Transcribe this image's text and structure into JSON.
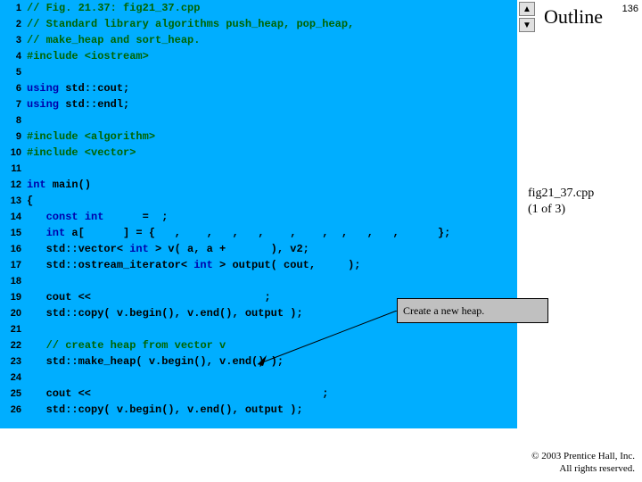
{
  "page_number": "136",
  "outline_label": "Outline",
  "fig_file": "fig21_37.cpp",
  "fig_part": "(1 of 3)",
  "callout_text": "Create a new heap.",
  "copyright_line1": "© 2003 Prentice Hall, Inc.",
  "copyright_line2": "All rights reserved.",
  "nav_up": "▲",
  "nav_down": "▼",
  "lines": [
    {
      "n": "1",
      "seg": [
        {
          "cls": "c",
          "t": "// Fig. 21.37: fig21_37.cpp"
        }
      ]
    },
    {
      "n": "2",
      "seg": [
        {
          "cls": "c",
          "t": "// Standard library algorithms push_heap, pop_heap,"
        }
      ]
    },
    {
      "n": "3",
      "seg": [
        {
          "cls": "c",
          "t": "// make_heap and sort_heap."
        }
      ]
    },
    {
      "n": "4",
      "seg": [
        {
          "cls": "pp",
          "t": "#include <iostream>"
        }
      ]
    },
    {
      "n": "5",
      "seg": [
        {
          "cls": "pl",
          "t": ""
        }
      ]
    },
    {
      "n": "6",
      "seg": [
        {
          "cls": "kw",
          "t": "using"
        },
        {
          "cls": "pl",
          "t": " std::cout;"
        }
      ]
    },
    {
      "n": "7",
      "seg": [
        {
          "cls": "kw",
          "t": "using"
        },
        {
          "cls": "pl",
          "t": " std::endl;"
        }
      ]
    },
    {
      "n": "8",
      "seg": [
        {
          "cls": "pl",
          "t": ""
        }
      ]
    },
    {
      "n": "9",
      "seg": [
        {
          "cls": "pp",
          "t": "#include <algorithm>"
        }
      ]
    },
    {
      "n": "10",
      "seg": [
        {
          "cls": "pp",
          "t": "#include <vector>"
        }
      ]
    },
    {
      "n": "11",
      "seg": [
        {
          "cls": "pl",
          "t": ""
        }
      ]
    },
    {
      "n": "12",
      "seg": [
        {
          "cls": "kw",
          "t": "int"
        },
        {
          "cls": "pl",
          "t": " main()"
        }
      ]
    },
    {
      "n": "13",
      "seg": [
        {
          "cls": "pl",
          "t": "{"
        }
      ]
    },
    {
      "n": "14",
      "seg": [
        {
          "cls": "pl",
          "t": "   "
        },
        {
          "cls": "kw",
          "t": "const int"
        },
        {
          "cls": "pl",
          "t": "      =  ;"
        }
      ]
    },
    {
      "n": "15",
      "seg": [
        {
          "cls": "pl",
          "t": "   "
        },
        {
          "cls": "kw",
          "t": "int"
        },
        {
          "cls": "pl",
          "t": " a[      ] = {   ,    ,   ,   ,    ,    ,  ,   ,   ,      };"
        }
      ]
    },
    {
      "n": "16",
      "seg": [
        {
          "cls": "pl",
          "t": "   std::vector< "
        },
        {
          "cls": "kw",
          "t": "int"
        },
        {
          "cls": "pl",
          "t": " > v( a, a +       ), v2;"
        }
      ]
    },
    {
      "n": "17",
      "seg": [
        {
          "cls": "pl",
          "t": "   std::ostream_iterator< "
        },
        {
          "cls": "kw",
          "t": "int"
        },
        {
          "cls": "pl",
          "t": " > output( cout,     );"
        }
      ]
    },
    {
      "n": "18",
      "seg": [
        {
          "cls": "pl",
          "t": ""
        }
      ]
    },
    {
      "n": "19",
      "seg": [
        {
          "cls": "pl",
          "t": "   cout <<                           ;"
        }
      ]
    },
    {
      "n": "20",
      "seg": [
        {
          "cls": "pl",
          "t": "   std::copy( v.begin(), v.end(), output );"
        }
      ]
    },
    {
      "n": "21",
      "seg": [
        {
          "cls": "pl",
          "t": ""
        }
      ]
    },
    {
      "n": "22",
      "seg": [
        {
          "cls": "pl",
          "t": "   "
        },
        {
          "cls": "c",
          "t": "// create heap from vector v"
        }
      ]
    },
    {
      "n": "23",
      "seg": [
        {
          "cls": "pl",
          "t": "   std::make_heap( v.begin(), v.end() );"
        }
      ]
    },
    {
      "n": "24",
      "seg": [
        {
          "cls": "pl",
          "t": ""
        }
      ]
    },
    {
      "n": "25",
      "seg": [
        {
          "cls": "pl",
          "t": "   cout <<                                    ;"
        }
      ]
    },
    {
      "n": "26",
      "seg": [
        {
          "cls": "pl",
          "t": "   std::copy( v.begin(), v.end(), output );"
        }
      ]
    }
  ]
}
